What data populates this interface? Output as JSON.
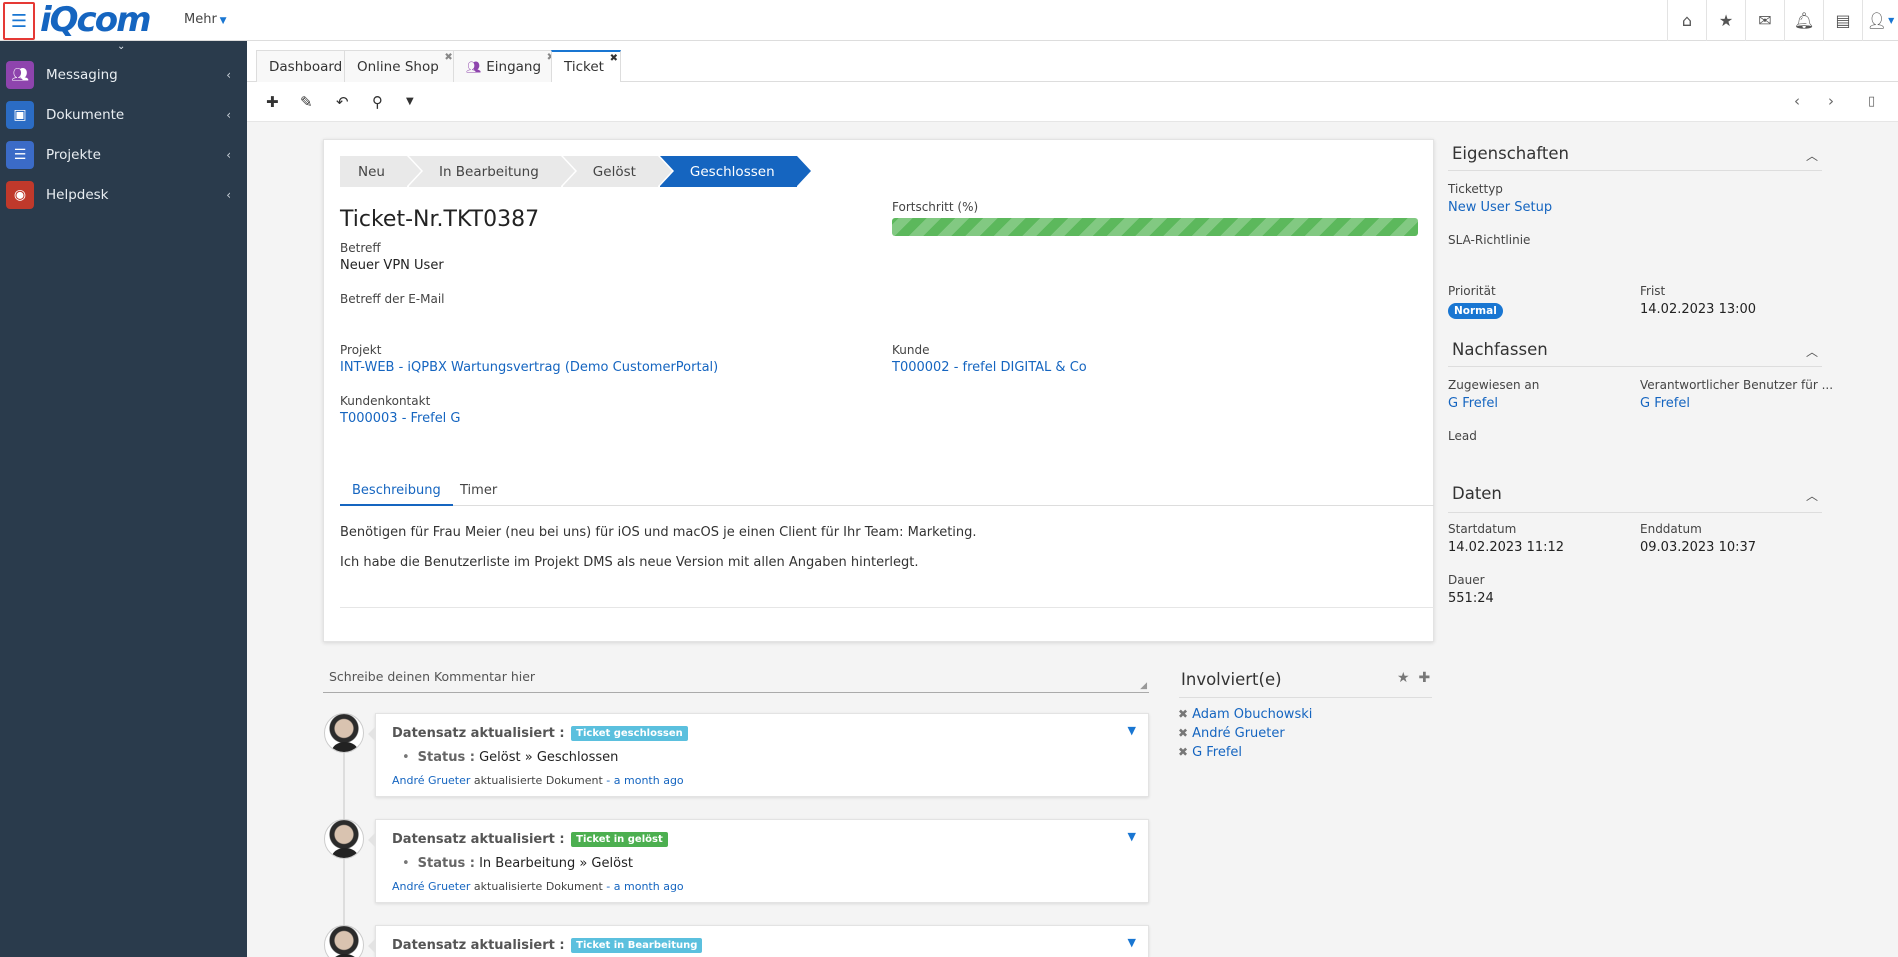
{
  "app": {
    "logo_text": "iQcom",
    "more_label": "Mehr"
  },
  "topbar_icons": [
    "home-icon",
    "star-icon",
    "envelope-icon",
    "bell-icon",
    "book-icon",
    "user-icon"
  ],
  "sidebar": {
    "items": [
      {
        "label": "Messaging",
        "icon": "users-icon",
        "color": "#8e44ad"
      },
      {
        "label": "Dokumente",
        "icon": "archive-icon",
        "color": "#2b6cc4"
      },
      {
        "label": "Projekte",
        "icon": "tasks-icon",
        "color": "#3b6bc7"
      },
      {
        "label": "Helpdesk",
        "icon": "lifebuoy-icon",
        "color": "#c0392b"
      }
    ]
  },
  "tabs": [
    {
      "label": "Dashboard"
    },
    {
      "label": "Online Shop"
    },
    {
      "label": "Eingang"
    },
    {
      "label": "Ticket"
    }
  ],
  "ticket": {
    "stages": [
      "Neu",
      "In Bearbeitung",
      "Gelöst",
      "Geschlossen"
    ],
    "active_stage": "Geschlossen",
    "title": "Ticket-Nr.TKT0387",
    "progress_label": "Fortschritt (%)",
    "progress_value": 100,
    "fields": {
      "betreff_label": "Betreff",
      "betreff_value": "Neuer VPN User",
      "email_betreff_label": "Betreff der E-Mail",
      "projekt_label": "Projekt",
      "projekt_value": "INT-WEB - iQPBX Wartungsvertrag (Demo CustomerPortal)",
      "kunde_label": "Kunde",
      "kunde_value": "T000002 - frefel DIGITAL & Co",
      "kontakt_label": "Kundenkontakt",
      "kontakt_value": "T000003 - Frefel G"
    },
    "inner_tabs": [
      "Beschreibung",
      "Timer"
    ],
    "description": [
      "Benötigen für Frau Meier (neu bei uns) für iOS und macOS je einen Client für Ihr Team: Marketing.",
      "Ich habe die Benutzerliste im Projekt DMS als neue Version mit allen Angaben hinterlegt."
    ]
  },
  "comment_placeholder": "Schreibe deinen Kommentar hier",
  "timeline": [
    {
      "heading": "Datensatz aktualisiert :",
      "badge": "Ticket geschlossen",
      "badge_color": "#5bc0de",
      "status_key": "Status :",
      "status_value": "Gelöst » Geschlossen",
      "author": "André Grueter",
      "action": "aktualisierte Dokument",
      "time": "- a month ago"
    },
    {
      "heading": "Datensatz aktualisiert :",
      "badge": "Ticket in gelöst",
      "badge_color": "#4caf50",
      "status_key": "Status :",
      "status_value": "In Bearbeitung » Gelöst",
      "author": "André Grueter",
      "action": "aktualisierte Dokument",
      "time": "- a month ago"
    },
    {
      "heading": "Datensatz aktualisiert :",
      "badge": "Ticket in Bearbeitung",
      "badge_color": "#5bc0de"
    }
  ],
  "involved": {
    "title": "Involviert(e)",
    "people": [
      "Adam Obuchowski",
      "André Grueter",
      "G Frefel"
    ]
  },
  "properties": {
    "title": "Eigenschaften",
    "tickettyp_label": "Tickettyp",
    "tickettyp_value": "New User Setup",
    "sla_label": "SLA-Richtlinie",
    "prioritaet_label": "Priorität",
    "prioritaet_value": "Normal",
    "frist_label": "Frist",
    "frist_value": "14.02.2023 13:00"
  },
  "followup": {
    "title": "Nachfassen",
    "assigned_label": "Zugewiesen an",
    "assigned_value": "G Frefel",
    "responsible_label": "Verantwortlicher Benutzer für ...",
    "responsible_value": "G Frefel",
    "lead_label": "Lead"
  },
  "dates": {
    "title": "Daten",
    "start_label": "Startdatum",
    "start_value": "14.02.2023 11:12",
    "end_label": "Enddatum",
    "end_value": "09.03.2023 10:37",
    "duration_label": "Dauer",
    "duration_value": "551:24"
  }
}
